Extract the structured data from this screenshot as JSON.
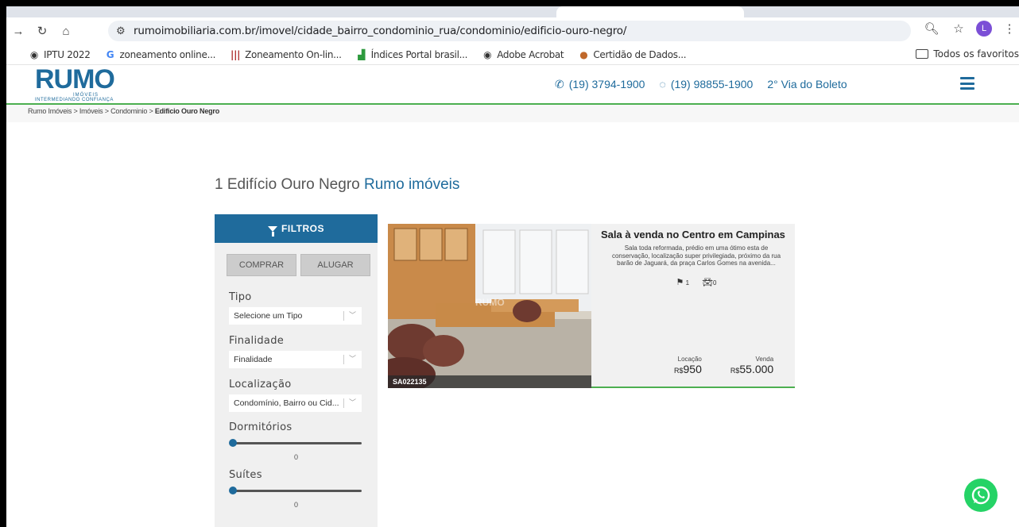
{
  "browser": {
    "url": "rumoimobiliaria.com.br/imovel/cidade_bairro_condominio_rua/condominio/edificio-ouro-negro/",
    "profile_initial": "L",
    "bookmarks": [
      {
        "icon": "globe-icon",
        "label": "IPTU 2022"
      },
      {
        "icon": "google-icon",
        "label": "zoneamento online..."
      },
      {
        "icon": "bars-logo-icon",
        "label": "Zoneamento On-lin..."
      },
      {
        "icon": "portal-icon",
        "label": "Índices Portal brasil..."
      },
      {
        "icon": "globe-icon",
        "label": "Adobe Acrobat"
      },
      {
        "icon": "seal-icon",
        "label": "Certidão de Dados..."
      }
    ],
    "favorites_label": "Todos os favoritos"
  },
  "header": {
    "logo_main": "RUMO",
    "logo_sub": "IMÓVEIS",
    "logo_tagline": "INTERMEDIANDO CONFIANÇA",
    "phone": "(19) 3794-1900",
    "whatsapp": "(19) 98855-1900",
    "boleto": "2° Via do Boleto"
  },
  "breadcrumb": {
    "items": [
      "Rumo Imóveis",
      "Imóveis",
      "Condominio"
    ],
    "current": "Edificio Ouro Negro",
    "separator": ">"
  },
  "page": {
    "count": "1",
    "title": "Edifício Ouro Negro",
    "brand": "Rumo imóveis"
  },
  "filters": {
    "header": "FILTROS",
    "buy_label": "COMPRAR",
    "rent_label": "ALUGAR",
    "tipo_label": "Tipo",
    "tipo_value": "Selecione um Tipo",
    "finalidade_label": "Finalidade",
    "finalidade_value": "Finalidade",
    "localizacao_label": "Localização",
    "localizacao_value": "Condomínio, Bairro ou Cid...",
    "dormitorios_label": "Dormitórios",
    "dormitorios_value": "0",
    "suites_label": "Suítes",
    "suites_value": "0"
  },
  "listing": {
    "code": "SA022135",
    "watermark": "RUMO",
    "title": "Sala à venda no Centro em Campinas",
    "description": "Sala toda reformada, prédio em uma ótimo esta de conservação, localização super privilegiada, próximo da rua barão de Jaguará, da praça Carlos Gomes na avenida...",
    "bathrooms": "1",
    "parking": "0",
    "rent_label": "Locação",
    "rent_currency": "R$",
    "rent_value": "950",
    "sale_label": "Venda",
    "sale_currency": "R$",
    "sale_value": "55.000"
  },
  "colors": {
    "brand_blue": "#1f6b9c",
    "brand_green": "#4caf50",
    "whatsapp_green": "#25d366"
  }
}
